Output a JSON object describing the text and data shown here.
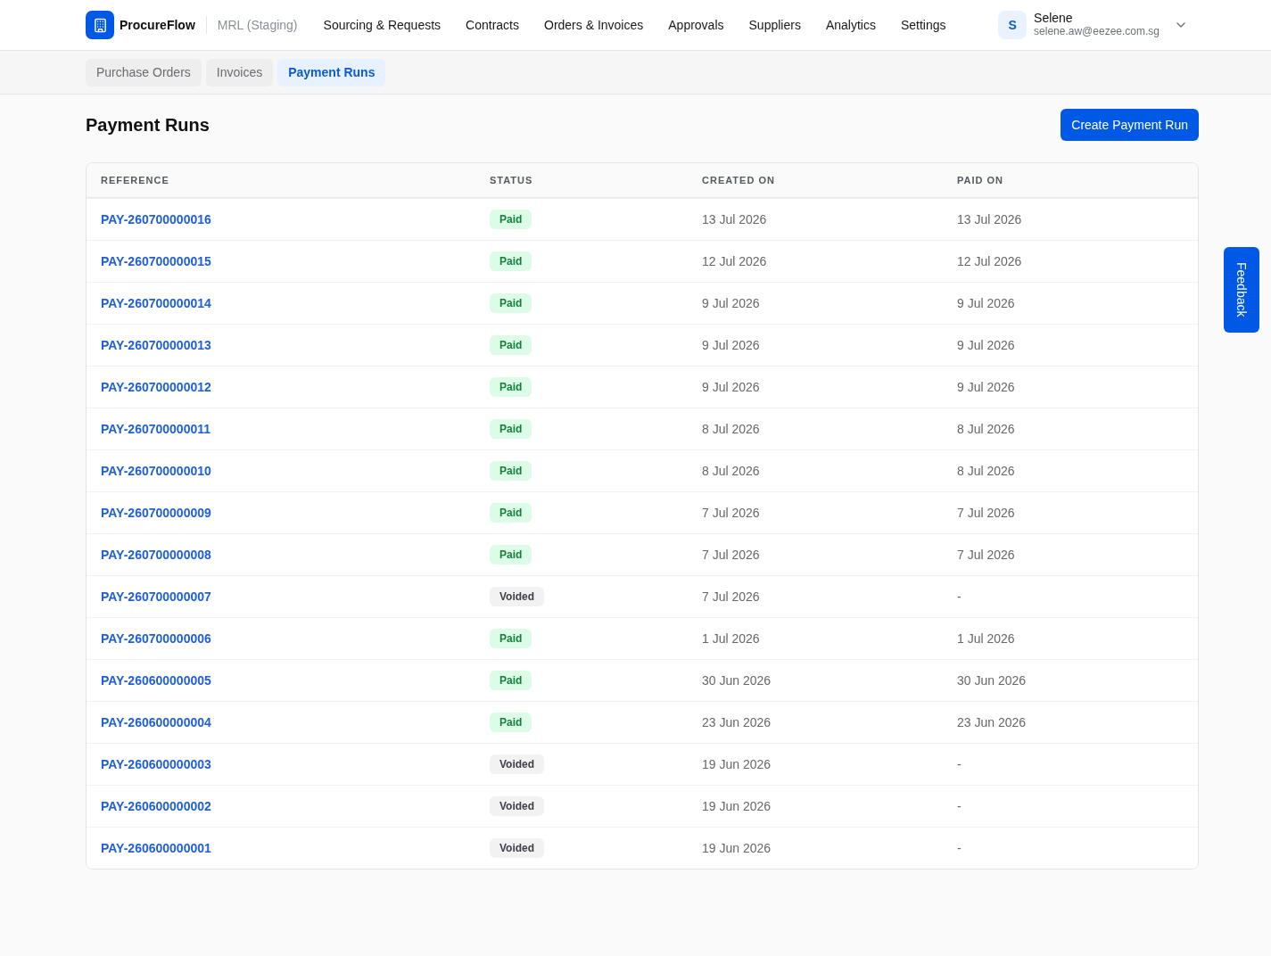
{
  "header": {
    "brand": "ProcureFlow",
    "environment": "MRL (Staging)",
    "nav": [
      "Sourcing & Requests",
      "Contracts",
      "Orders & Invoices",
      "Approvals",
      "Suppliers",
      "Analytics",
      "Settings"
    ],
    "user": {
      "initial": "S",
      "name": "Selene",
      "email": "selene.aw@eezee.com.sg"
    }
  },
  "subtabs": [
    {
      "label": "Purchase Orders",
      "selected": false
    },
    {
      "label": "Invoices",
      "selected": false
    },
    {
      "label": "Payment Runs",
      "selected": true
    }
  ],
  "page": {
    "title": "Payment Runs",
    "primary_action": "Create Payment Run"
  },
  "table": {
    "columns": [
      "REFERENCE",
      "STATUS",
      "CREATED ON",
      "PAID ON"
    ],
    "rows": [
      {
        "reference": "PAY-260700000016",
        "status": {
          "label": "Paid",
          "kind": "paid"
        },
        "created_on": "13 Jul 2026",
        "paid_on": "13 Jul 2026"
      },
      {
        "reference": "PAY-260700000015",
        "status": {
          "label": "Paid",
          "kind": "paid"
        },
        "created_on": "12 Jul 2026",
        "paid_on": "12 Jul 2026"
      },
      {
        "reference": "PAY-260700000014",
        "status": {
          "label": "Paid",
          "kind": "paid"
        },
        "created_on": "9 Jul 2026",
        "paid_on": "9 Jul 2026"
      },
      {
        "reference": "PAY-260700000013",
        "status": {
          "label": "Paid",
          "kind": "paid"
        },
        "created_on": "9 Jul 2026",
        "paid_on": "9 Jul 2026"
      },
      {
        "reference": "PAY-260700000012",
        "status": {
          "label": "Paid",
          "kind": "paid"
        },
        "created_on": "9 Jul 2026",
        "paid_on": "9 Jul 2026"
      },
      {
        "reference": "PAY-260700000011",
        "status": {
          "label": "Paid",
          "kind": "paid"
        },
        "created_on": "8 Jul 2026",
        "paid_on": "8 Jul 2026"
      },
      {
        "reference": "PAY-260700000010",
        "status": {
          "label": "Paid",
          "kind": "paid"
        },
        "created_on": "8 Jul 2026",
        "paid_on": "8 Jul 2026"
      },
      {
        "reference": "PAY-260700000009",
        "status": {
          "label": "Paid",
          "kind": "paid"
        },
        "created_on": "7 Jul 2026",
        "paid_on": "7 Jul 2026"
      },
      {
        "reference": "PAY-260700000008",
        "status": {
          "label": "Paid",
          "kind": "paid"
        },
        "created_on": "7 Jul 2026",
        "paid_on": "7 Jul 2026"
      },
      {
        "reference": "PAY-260700000007",
        "status": {
          "label": "Voided",
          "kind": "voided"
        },
        "created_on": "7 Jul 2026",
        "paid_on": "-"
      },
      {
        "reference": "PAY-260700000006",
        "status": {
          "label": "Paid",
          "kind": "paid"
        },
        "created_on": "1 Jul 2026",
        "paid_on": "1 Jul 2026"
      },
      {
        "reference": "PAY-260600000005",
        "status": {
          "label": "Paid",
          "kind": "paid"
        },
        "created_on": "30 Jun 2026",
        "paid_on": "30 Jun 2026"
      },
      {
        "reference": "PAY-260600000004",
        "status": {
          "label": "Paid",
          "kind": "paid"
        },
        "created_on": "23 Jun 2026",
        "paid_on": "23 Jun 2026"
      },
      {
        "reference": "PAY-260600000003",
        "status": {
          "label": "Voided",
          "kind": "voided"
        },
        "created_on": "19 Jun 2026",
        "paid_on": "-"
      },
      {
        "reference": "PAY-260600000002",
        "status": {
          "label": "Voided",
          "kind": "voided"
        },
        "created_on": "19 Jun 2026",
        "paid_on": "-"
      },
      {
        "reference": "PAY-260600000001",
        "status": {
          "label": "Voided",
          "kind": "voided"
        },
        "created_on": "19 Jun 2026",
        "paid_on": "-"
      }
    ]
  },
  "feedback_button": "Feedback"
}
